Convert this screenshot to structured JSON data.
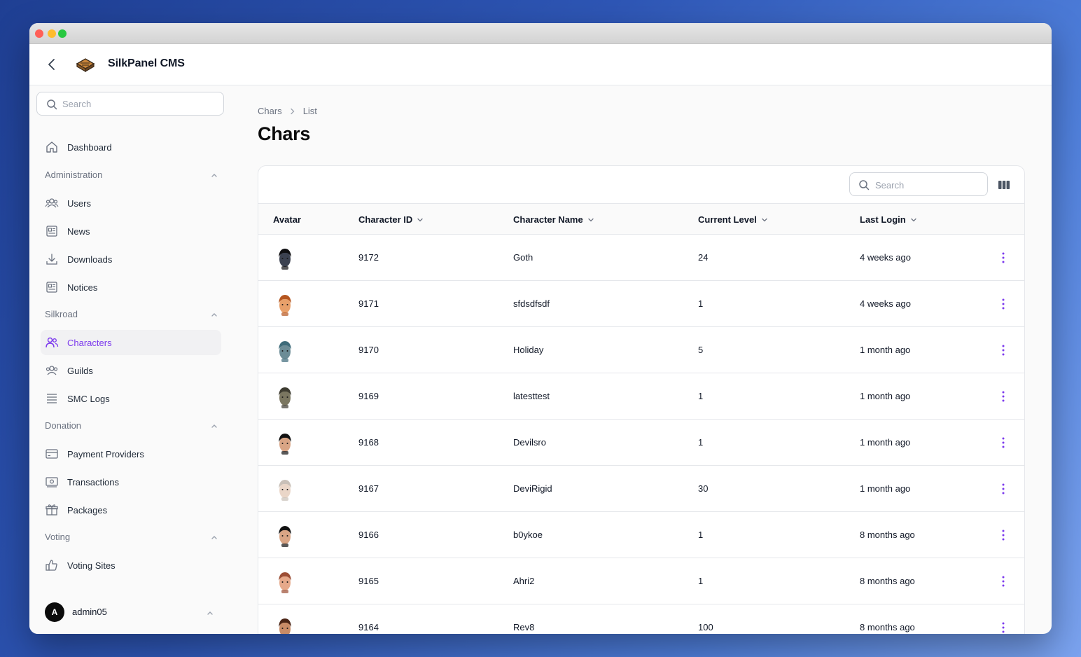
{
  "app": {
    "name": "SilkPanel CMS"
  },
  "sidebar": {
    "search_placeholder": "Search",
    "dashboard": "Dashboard",
    "groups": {
      "administration": {
        "label": "Administration",
        "items": [
          "Users",
          "News",
          "Downloads",
          "Notices"
        ]
      },
      "silkroad": {
        "label": "Silkroad",
        "items": [
          "Characters",
          "Guilds",
          "SMC Logs"
        ]
      },
      "donation": {
        "label": "Donation",
        "items": [
          "Payment Providers",
          "Transactions",
          "Packages"
        ]
      },
      "voting": {
        "label": "Voting",
        "items": [
          "Voting Sites"
        ]
      }
    },
    "active_item": "Characters"
  },
  "user": {
    "initial": "A",
    "name": "admin05"
  },
  "breadcrumb": [
    "Chars",
    "List"
  ],
  "page_title": "Chars",
  "table": {
    "search_placeholder": "Search",
    "columns": [
      "Avatar",
      "Character ID",
      "Character Name",
      "Current Level",
      "Last Login"
    ],
    "rows": [
      {
        "id": "9172",
        "name": "Goth",
        "level": "24",
        "last_login": "4 weeks ago",
        "avatar": {
          "skin": "#3b4150",
          "hair": "#0f0f12"
        }
      },
      {
        "id": "9171",
        "name": "sfdsdfsdf",
        "level": "1",
        "last_login": "4 weeks ago",
        "avatar": {
          "skin": "#e8a06a",
          "hair": "#b5561f"
        }
      },
      {
        "id": "9170",
        "name": "Holiday",
        "level": "5",
        "last_login": "1 month ago",
        "avatar": {
          "skin": "#6c8c96",
          "hair": "#3e6b7a"
        }
      },
      {
        "id": "9169",
        "name": "latesttest",
        "level": "1",
        "last_login": "1 month ago",
        "avatar": {
          "skin": "#7a7660",
          "hair": "#3d3b30"
        }
      },
      {
        "id": "9168",
        "name": "Devilsro",
        "level": "1",
        "last_login": "1 month ago",
        "avatar": {
          "skin": "#d9a585",
          "hair": "#121212"
        }
      },
      {
        "id": "9167",
        "name": "DeviRigid",
        "level": "30",
        "last_login": "1 month ago",
        "avatar": {
          "skin": "#ead6c8",
          "hair": "#c9c0b8"
        }
      },
      {
        "id": "9166",
        "name": "b0ykoe",
        "level": "1",
        "last_login": "8 months ago",
        "avatar": {
          "skin": "#d9a585",
          "hair": "#121212"
        }
      },
      {
        "id": "9165",
        "name": "Ahri2",
        "level": "1",
        "last_login": "8 months ago",
        "avatar": {
          "skin": "#e6a98a",
          "hair": "#9c4e35"
        }
      },
      {
        "id": "9164",
        "name": "Rev8",
        "level": "100",
        "last_login": "8 months ago",
        "avatar": {
          "skin": "#c98b66",
          "hair": "#4a2415"
        }
      }
    ]
  },
  "colors": {
    "accent": "#7c3aed",
    "text": "#111827",
    "muted": "#6b7280"
  }
}
